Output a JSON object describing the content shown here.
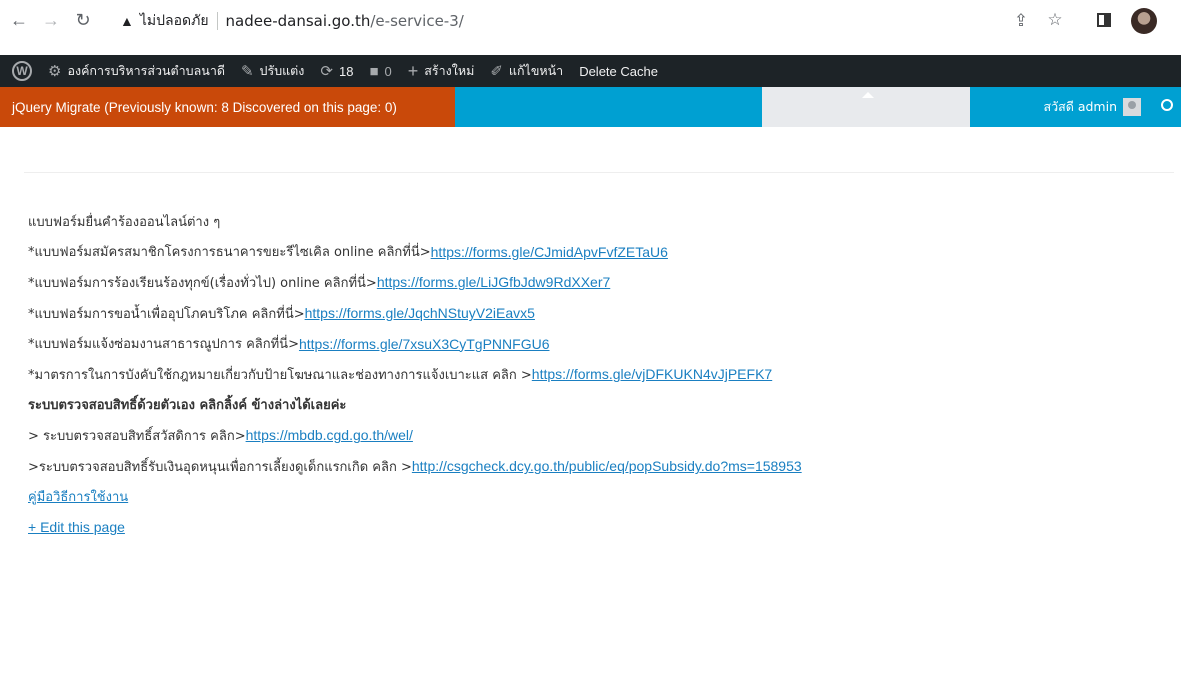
{
  "browser": {
    "insecure_label": "ไม่ปลอดภัย",
    "url_host": "nadee-dansai.go.th",
    "url_path": "/e-service-3/"
  },
  "adminbar": {
    "site_name": "องค์การบริหารส่วนตำบลนาดี",
    "customize": "ปรับแต่ง",
    "updates_count": "18",
    "comments_count": "0",
    "new_label": "สร้างใหม่",
    "edit_label": "แก้ไขหน้า",
    "delete_cache": "Delete Cache"
  },
  "toolbar": {
    "jquery_migrate": "jQuery Migrate (Previously known: 8 Discovered on this page: 0)",
    "greeting": "สวัสดี admin"
  },
  "content": {
    "intro": "แบบฟอร์มยื่นคำร้องออนไลน์ต่าง ๆ",
    "items": [
      {
        "text": "*แบบฟอร์มสมัครสมาชิกโครงการธนาคารขยะรีไซเคิล online คลิกที่นี่>",
        "link": "https://forms.gle/CJmidApvFvfZETaU6"
      },
      {
        "text": "*แบบฟอร์มการร้องเรียนร้องทุกข์(เรื่องทั่วไป) online คลิกที่นี่>",
        "link": "https://forms.gle/LiJGfbJdw9RdXXer7"
      },
      {
        "text": "*แบบฟอร์มการขอน้ำเพื่ออุปโภคบริโภค คลิกที่นี่>",
        "link": "https://forms.gle/JqchNStuyV2iEavx5"
      },
      {
        "text": "*แบบฟอร์มแจ้งซ่อมงานสาธารณูปการ คลิกที่นี่>",
        "link": "https://forms.gle/7xsuX3CyTgPNNFGU6"
      },
      {
        "text": "*มาตรการในการบังคับใช้กฎหมายเกี่ยวกับป้ายโฆษณาและช่องทางการแจ้งเบาะแส คลิก > ",
        "link": "https://forms.gle/vjDFKUKN4vJjPEFK7"
      }
    ],
    "heading": "ระบบตรวจสอบสิทธิ์ด้วยตัวเอง คลิกลิ้งค์ ข้างล่างได้เลยค่ะ",
    "checks": [
      {
        "text": "> ระบบตรวจสอบสิทธิ์สวัสดิการ คลิก>",
        "link": "https://mbdb.cgd.go.th/wel/"
      },
      {
        "text": ">ระบบตรวจสอบสิทธิ์รับเงินอุดหนุนเพื่อการเลี้ยงดูเด็กแรกเกิด คลิก >",
        "link": "http://csgcheck.dcy.go.th/public/eq/popSubsidy.do?ms=158953"
      }
    ],
    "manual_link": "คู่มือวิธีการใช้งาน",
    "edit_page": "+ Edit this page"
  }
}
